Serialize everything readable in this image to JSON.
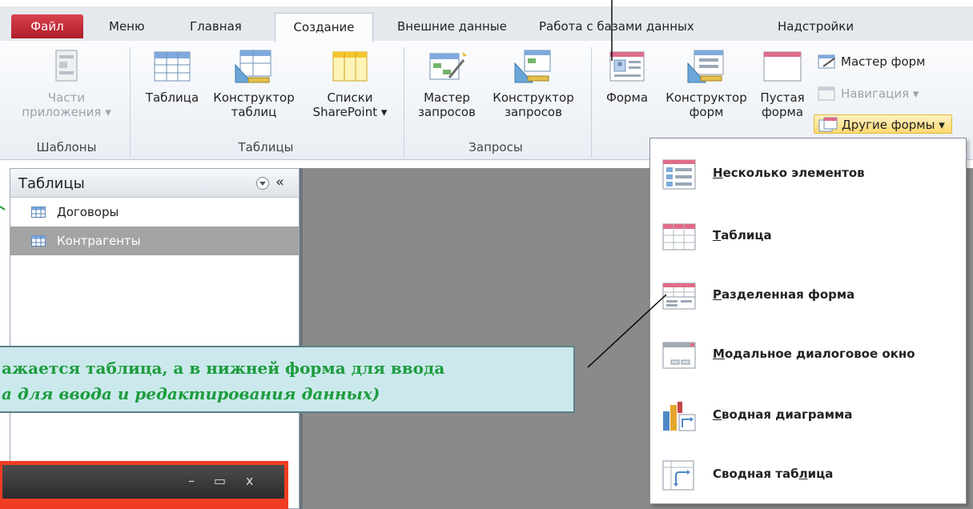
{
  "tabs": {
    "file": "Файл",
    "menu": "Меню",
    "home": "Главная",
    "create": "Создание",
    "external": "Внешние данные",
    "database": "Работа с базами данных",
    "addins": "Надстройки"
  },
  "ribbon": {
    "templates": {
      "app_parts_line1": "Части",
      "app_parts_line2": "приложения ▾",
      "label": "Шаблоны"
    },
    "tables": {
      "table": "Таблица",
      "designer_line1": "Конструктор",
      "designer_line2": "таблиц",
      "sp_line1": "Списки",
      "sp_line2": "SharePoint ▾",
      "label": "Таблицы"
    },
    "queries": {
      "wizard_line1": "Мастер",
      "wizard_line2": "запросов",
      "designer_line1": "Конструктор",
      "designer_line2": "запросов",
      "label": "Запросы"
    },
    "forms": {
      "form": "Форма",
      "designer_line1": "Конструктор",
      "designer_line2": "форм",
      "blank_line1": "Пустая",
      "blank_line2": "форма",
      "wizard": "Мастер форм",
      "navigation": "Навигация ▾",
      "other": "Другие формы ▾"
    }
  },
  "nav": {
    "title": "Таблицы",
    "collapse": "«",
    "items": [
      "Договоры",
      "Контрагенты"
    ]
  },
  "dropdown": {
    "items": [
      {
        "key": "Н",
        "rest": "есколько элементов"
      },
      {
        "key": "Т",
        "rest": "аблица"
      },
      {
        "key": "Р",
        "rest": "азделенная форма"
      },
      {
        "key": "М",
        "rest": "одальное диалоговое окно"
      },
      {
        "key": "С",
        "rest": "водная диаграмма"
      },
      {
        "pre": "Сводная таб",
        "key": "л",
        "rest": "ица"
      }
    ]
  },
  "callout": {
    "line1": "ажается таблица, а в нижней форма для ввода",
    "line2": "а для ввода и редактирования данных)"
  },
  "overlay": {
    "minimize": "–",
    "maximize": "▭",
    "close": "x"
  },
  "colors": {
    "file_tab": "#c62a36",
    "callout_bg": "#cbe9ec",
    "callout_text": "#1c9c3d",
    "overlay_border": "#ef3c23",
    "workspace": "#8a8a8a"
  }
}
